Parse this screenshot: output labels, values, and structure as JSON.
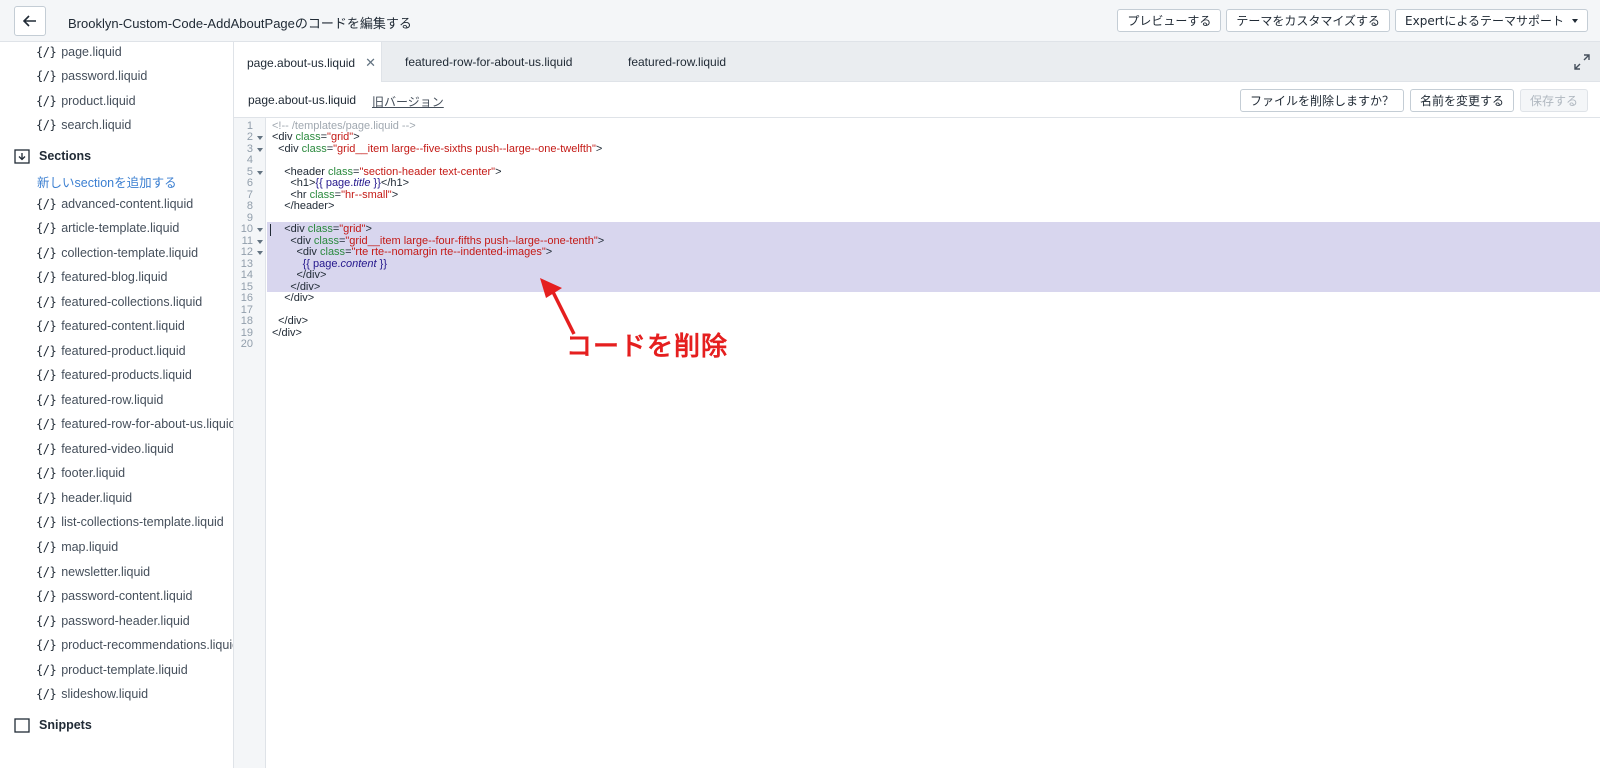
{
  "header": {
    "title": "Brooklyn-Custom-Code-AddAboutPageのコードを編集する",
    "preview_label": "プレビューする",
    "customize_label": "テーマをカスタマイズする",
    "support_label": "Expertによるテーマサポート"
  },
  "sidebar": {
    "templates_tail": [
      "page.liquid",
      "password.liquid",
      "product.liquid",
      "search.liquid"
    ],
    "sections_label": "Sections",
    "add_section_label": "新しいsectionを追加する",
    "section_files": [
      "advanced-content.liquid",
      "article-template.liquid",
      "collection-template.liquid",
      "featured-blog.liquid",
      "featured-collections.liquid",
      "featured-content.liquid",
      "featured-product.liquid",
      "featured-products.liquid",
      "featured-row.liquid",
      "featured-row-for-about-us.liquid",
      "featured-video.liquid",
      "footer.liquid",
      "header.liquid",
      "list-collections-template.liquid",
      "map.liquid",
      "newsletter.liquid",
      "password-content.liquid",
      "password-header.liquid",
      "product-recommendations.liquid",
      "product-template.liquid",
      "slideshow.liquid"
    ],
    "snippets_label": "Snippets",
    "file_icon": "{/}"
  },
  "tabs": [
    {
      "label": "page.about-us.liquid",
      "active": true
    },
    {
      "label": "featured-row-for-about-us.liquid",
      "active": false
    },
    {
      "label": "featured-row.liquid",
      "active": false
    }
  ],
  "filebar": {
    "filename": "page.about-us.liquid",
    "old_version_label": "旧バージョン",
    "delete_label": "ファイルを削除しますか？",
    "rename_label": "名前を変更する",
    "save_label": "保存する"
  },
  "editor": {
    "line_numbers": [
      "1",
      "2",
      "3",
      "4",
      "5",
      "6",
      "7",
      "8",
      "9",
      "10",
      "11",
      "12",
      "13",
      "14",
      "15",
      "16",
      "17",
      "18",
      "19",
      "20"
    ],
    "selected_lines": "10-16"
  },
  "annotation": {
    "text": "コードを削除",
    "color": "#e51f1f"
  },
  "colors": {
    "selection": "#d8d6ee",
    "link": "#3b7fd1",
    "attribute": "#2b8a3e",
    "string": "#c41a16"
  }
}
